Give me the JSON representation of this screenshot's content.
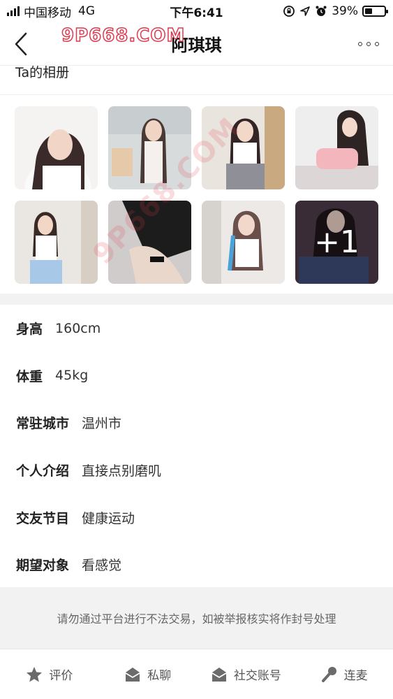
{
  "status_bar": {
    "carrier": "中国移动",
    "network": "4G",
    "time": "下午6:41",
    "battery_percent": "39%",
    "battery_level": 0.39
  },
  "nav": {
    "title": "阿琪琪",
    "watermark": "9P668.COM"
  },
  "album": {
    "header": "Ta的相册",
    "more_count": "+1",
    "photos": [
      {
        "icon": "photo-thumbnail"
      },
      {
        "icon": "photo-thumbnail"
      },
      {
        "icon": "photo-thumbnail"
      },
      {
        "icon": "photo-thumbnail"
      },
      {
        "icon": "photo-thumbnail"
      },
      {
        "icon": "photo-thumbnail"
      },
      {
        "icon": "photo-thumbnail"
      },
      {
        "icon": "photo-thumbnail"
      }
    ]
  },
  "profile": {
    "height_label": "身高",
    "height_value": "160cm",
    "weight_label": "体重",
    "weight_value": "45kg",
    "city_label": "常驻城市",
    "city_value": "温州市",
    "intro_label": "个人介绍",
    "intro_value": "直接点别磨叽",
    "program_label": "交友节目",
    "program_value": "健康运动",
    "expect_label": "期望对象",
    "expect_value": "看感觉"
  },
  "notice": "请勿通过平台进行不法交易，如被举报核实将作封号处理",
  "bottom_bar": {
    "review": "评价",
    "message": "私聊",
    "social": "社交账号",
    "mic": "连麦"
  },
  "colors": {
    "accent_watermark": "#e0394e",
    "icon_gray": "#666666",
    "divider": "#f2f2f2"
  }
}
